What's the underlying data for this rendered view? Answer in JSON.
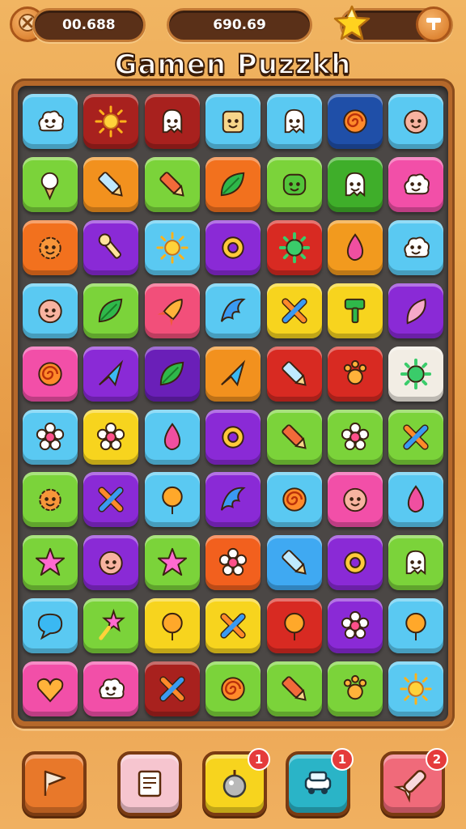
{
  "top_bar": {
    "left_value": "00.688",
    "center_value": "690.69",
    "menu_icon": "x-gear-icon",
    "star_icon": "star-icon",
    "right_icon": "hammer-icon"
  },
  "title": "Gamen Puzzkh",
  "board": {
    "cols": 7,
    "rows": 10,
    "tiles": [
      [
        "blue",
        "cloud-face",
        "#5ac9f2"
      ],
      [
        "darkred",
        "sun",
        "#a8211e"
      ],
      [
        "darkred",
        "ghost",
        "#a8211e"
      ],
      [
        "blue",
        "robot-face",
        "#5ac9f2"
      ],
      [
        "blue",
        "ghost-alt",
        "#5ac9f2"
      ],
      [
        "navy",
        "swirl",
        "#1f4fa8"
      ],
      [
        "blue",
        "blob",
        "#5ac9f2"
      ],
      [
        "green",
        "ice-cream",
        "#7bd33a"
      ],
      [
        "orange",
        "syringe",
        "#f2911e"
      ],
      [
        "green",
        "crayon",
        "#7bd33a"
      ],
      [
        "orange",
        "leaf",
        "#f2711e"
      ],
      [
        "green",
        "frog-face",
        "#7bd33a"
      ],
      [
        "darkgreen",
        "ghost-face",
        "#3fae2a"
      ],
      [
        "pink",
        "cloud-face",
        "#f24fa8"
      ],
      [
        "orange",
        "gear-face",
        "#f2711e"
      ],
      [
        "purple",
        "wrench",
        "#8a2ad6"
      ],
      [
        "blue",
        "sun",
        "#5ac9f2"
      ],
      [
        "purple",
        "ring",
        "#8a2ad6"
      ],
      [
        "red",
        "virus",
        "#d82a22"
      ],
      [
        "orange",
        "drop",
        "#f29a1e"
      ],
      [
        "blue",
        "cloud-face",
        "#5ac9f2"
      ],
      [
        "blue",
        "face",
        "#5ac9f2"
      ],
      [
        "green",
        "leaf",
        "#7bd33a"
      ],
      [
        "pink",
        "rocket",
        "#f24f7a"
      ],
      [
        "blue",
        "wing",
        "#5ac9f2"
      ],
      [
        "yellow",
        "cross",
        "#f7d41e"
      ],
      [
        "yellow",
        "hammer",
        "#f7d41e"
      ],
      [
        "purple",
        "feather",
        "#8a2ad6"
      ],
      [
        "pink",
        "swirl",
        "#f24fa8"
      ],
      [
        "purple",
        "kite",
        "#8a2ad6"
      ],
      [
        "purple",
        "leaf",
        "#6a1fb8"
      ],
      [
        "orange",
        "plane",
        "#f2911e"
      ],
      [
        "red",
        "syringe",
        "#d82a22"
      ],
      [
        "red",
        "paw",
        "#d82a22"
      ],
      [
        "white",
        "virus",
        "#f2ede4"
      ],
      [
        "blue",
        "flower",
        "#5ac9f2"
      ],
      [
        "yellow",
        "flower",
        "#f7d41e"
      ],
      [
        "blue",
        "drop",
        "#5ac9f2"
      ],
      [
        "purple",
        "donut",
        "#8a2ad6"
      ],
      [
        "green",
        "crayon",
        "#7bd33a"
      ],
      [
        "green",
        "flower",
        "#7bd33a"
      ],
      [
        "green",
        "cross",
        "#7bd33a"
      ],
      [
        "green",
        "gear-face",
        "#7bd33a"
      ],
      [
        "purple",
        "cross",
        "#8a2ad6"
      ],
      [
        "blue",
        "balloon",
        "#5ac9f2"
      ],
      [
        "purple",
        "wing",
        "#8a2ad6"
      ],
      [
        "blue",
        "swirl",
        "#5ac9f2"
      ],
      [
        "pink",
        "face",
        "#f24fa8"
      ],
      [
        "blue",
        "drop",
        "#5ac9f2"
      ],
      [
        "green",
        "star",
        "#7bd33a"
      ],
      [
        "purple",
        "blob",
        "#8a2ad6"
      ],
      [
        "green",
        "star",
        "#7bd33a"
      ],
      [
        "red",
        "flower",
        "#f2601e"
      ],
      [
        "blue",
        "syringe",
        "#3fa9f2"
      ],
      [
        "purple",
        "ring",
        "#8a2ad6"
      ],
      [
        "green",
        "ghost-alt",
        "#7bd33a"
      ],
      [
        "blue",
        "bubble",
        "#5ac9f2"
      ],
      [
        "green",
        "star-pin",
        "#7bd33a"
      ],
      [
        "yellow",
        "balloon",
        "#f7d41e"
      ],
      [
        "yellow",
        "cross",
        "#f7d41e"
      ],
      [
        "red",
        "balloon",
        "#d82a22"
      ],
      [
        "purple",
        "flower",
        "#8a2ad6"
      ],
      [
        "blue",
        "balloon",
        "#5ac9f2"
      ],
      [
        "pink",
        "heart",
        "#f24fa8"
      ],
      [
        "pink",
        "cloud-face",
        "#f24fa8"
      ],
      [
        "darkred",
        "cross",
        "#a8211e"
      ],
      [
        "green",
        "swirl",
        "#7bd33a"
      ],
      [
        "green",
        "crayon",
        "#7bd33a"
      ],
      [
        "green",
        "paw",
        "#7bd33a"
      ],
      [
        "blue",
        "sun",
        "#5ac9f2"
      ]
    ]
  },
  "powerups": [
    {
      "name": "flag",
      "color": "#e8782a",
      "badge": ""
    },
    {
      "name": "scroll",
      "color": "#f6c5cf",
      "badge": ""
    },
    {
      "name": "bomb",
      "color": "#f7d41e",
      "badge": "1"
    },
    {
      "name": "car",
      "color": "#2ab4c7",
      "badge": "1"
    },
    {
      "name": "rocket",
      "color": "#f06a7a",
      "badge": "2"
    }
  ]
}
